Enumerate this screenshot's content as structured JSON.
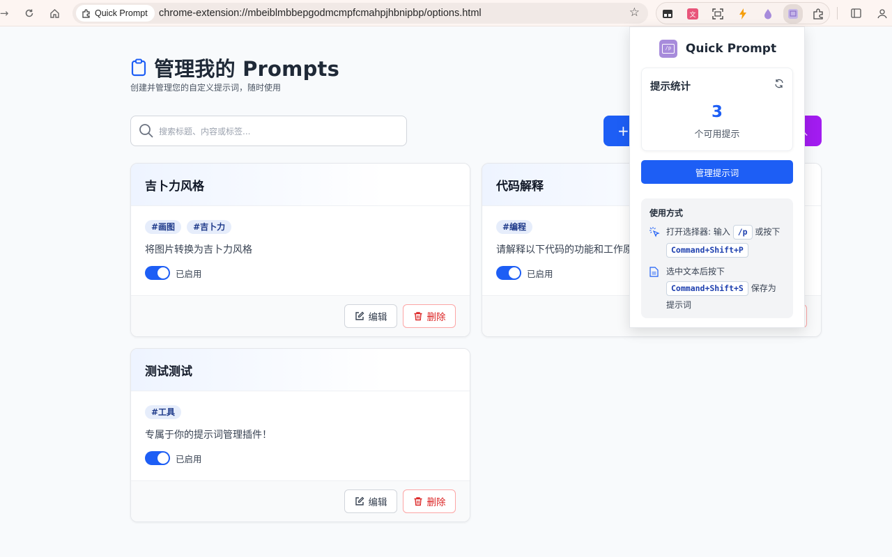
{
  "browser": {
    "tab_chip": "Quick Prompt",
    "url": "chrome-extension://mbeiblmbbepgodmcmpfcmahpjhbnipbp/options.html"
  },
  "page": {
    "title": "管理我的 Prompts",
    "subtitle": "创建并管理您的自定义提示词，随时使用",
    "search_placeholder": "搜索标题、内容或标签...",
    "add_label": "+",
    "import_label": "入"
  },
  "cards": [
    {
      "title": "吉卜力风格",
      "tags": [
        "#画图",
        "#吉卜力"
      ],
      "description": "将图片转换为吉卜力风格",
      "enabled_label": "已启用",
      "edit_label": "编辑",
      "delete_label": "删除"
    },
    {
      "title": "代码解释",
      "tags": [
        "#编程"
      ],
      "description": "请解释以下代码的功能和工作原",
      "enabled_label": "已启用",
      "edit_label": "编辑",
      "delete_label": "删除"
    },
    {
      "title": "测试测试",
      "tags": [
        "#工具"
      ],
      "description": "专属于你的提示词管理插件！",
      "enabled_label": "已启用",
      "edit_label": "编辑",
      "delete_label": "删除"
    }
  ],
  "popup": {
    "name": "Quick Prompt",
    "logo_text": "/p",
    "stats_label": "提示统计",
    "count": "3",
    "count_label": "个可用提示",
    "manage_button": "管理提示词",
    "usage_title": "使用方式",
    "usage_1_pre": "打开选择器: 输入",
    "usage_1_kbd1": "/p",
    "usage_1_mid": "或按下",
    "usage_1_kbd2": "Command+Shift+P",
    "usage_2_pre": "选中文本后按下",
    "usage_2_kbd": "Command+Shift+S",
    "usage_2_post": "保存为",
    "usage_2_post2": "提示词"
  },
  "colors": {
    "primary": "#1d5ef5",
    "import": "#a21cf0",
    "danger": "#dc2626"
  }
}
